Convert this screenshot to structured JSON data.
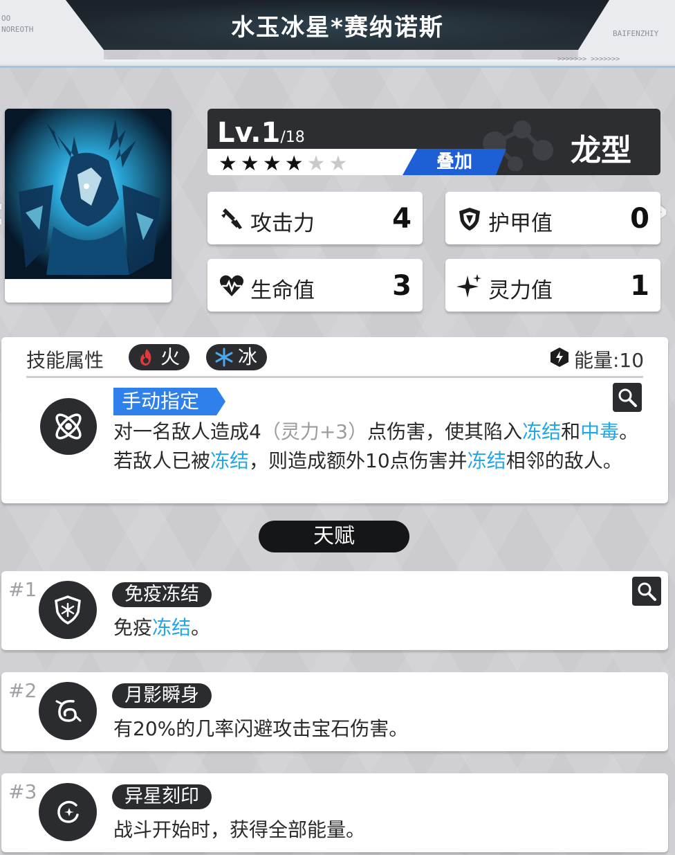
{
  "header": {
    "title": "水玉冰星*赛纳诺斯",
    "left_deco": [
      "OO",
      "NOREOTH"
    ],
    "right_deco": [
      "BAIFENZHIY",
      ">>>>>>>  >>>>>>>"
    ]
  },
  "card": {
    "level_prefix": "Lv.1",
    "level_max": "/18",
    "stars_filled": 4,
    "stars_total": 6,
    "stack_label": "叠加",
    "type_label": "龙型"
  },
  "stats": {
    "attack": {
      "label": "攻击力",
      "value": "4",
      "icon": "sword-icon"
    },
    "armor": {
      "label": "护甲值",
      "value": "0",
      "icon": "shield-icon"
    },
    "health": {
      "label": "生命值",
      "value": "3",
      "icon": "heart-icon"
    },
    "spirit": {
      "label": "灵力值",
      "value": "1",
      "icon": "sparkle-icon"
    }
  },
  "skill": {
    "heading": "技能属性",
    "elements": [
      {
        "label": "火",
        "icon": "fire-icon",
        "color": "#e23a3a"
      },
      {
        "label": "冰",
        "icon": "snowflake-icon",
        "color": "#4aa8f0"
      }
    ],
    "energy_label": "能量:10",
    "target_tag": "手动指定",
    "desc_parts": {
      "p1": "对一名敌人造成4",
      "p2": "（灵力+3）",
      "p3": "点伤害，使其陷入",
      "k1": "冻结",
      "p4": "和",
      "k2": "中毒",
      "p5": "。若敌人已被",
      "k3": "冻结",
      "p6": "，则造成额外10点伤害并",
      "k4": "冻结",
      "p7": "相邻的敌人。"
    }
  },
  "talent_header": "天赋",
  "talents": [
    {
      "index": "#1",
      "name": "免疫冻结",
      "desc_pre": "免疫",
      "desc_kw": "冻结",
      "desc_post": "。",
      "icon": "frost-shield-icon"
    },
    {
      "index": "#2",
      "name": "月影瞬身",
      "desc": "有20%的几率闪避攻击宝石伤害。",
      "icon": "swirl-icon"
    },
    {
      "index": "#3",
      "name": "异星刻印",
      "desc": "战斗开始时，获得全部能量。",
      "icon": "planet-mark-icon"
    }
  ],
  "colors": {
    "accent_blue": "#2f80ea",
    "keyword_blue": "#21a6e8",
    "dark": "#2b2c30"
  }
}
